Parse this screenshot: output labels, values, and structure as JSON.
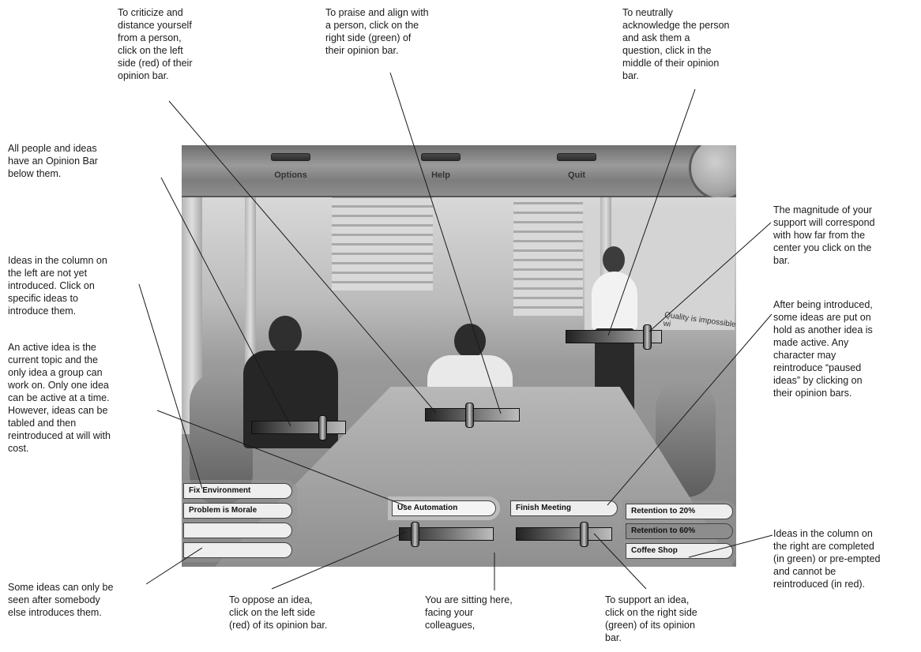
{
  "menu": {
    "options": "Options",
    "help": "Help",
    "quit": "Quit"
  },
  "scene": {
    "wall_sign": "Quality is impossible wi"
  },
  "ideas_left": [
    "Fix Environment",
    "Problem is Morale",
    "",
    ""
  ],
  "active_idea": "Use Automation",
  "paused_idea": "Finish Meeting",
  "ideas_right": [
    "Retention to 20%",
    "Retention to 60%",
    "Coffee Shop"
  ],
  "opinion_bars": {
    "person_left": 0.78,
    "person_center": 0.46,
    "person_right": 0.88,
    "active_idea": 0.13,
    "paused_idea": 0.73
  },
  "colors": {
    "oppose_side": "#cc0000",
    "support_side": "#009900"
  },
  "annotations": {
    "criticize": "To criticize and\ndistance yourself\nfrom a person,\nclick on the left\nside (red) of their\nopinion bar.",
    "praise": "To praise and align with\na person, click on the\nright side (green) of\ntheir opinion bar.",
    "neutral": "To neutrally\nacknowledge the person\nand ask them a\nquestion, click in the\nmiddle of their opinion\nbar.",
    "opinion_bar": "All people and ideas\nhave an Opinion Bar\nbelow them.",
    "magnitude": "The magnitude of your\nsupport will correspond\nwith how far from the\ncenter you click on the\nbar.",
    "left_column": "Ideas in the column on\nthe left are not yet\nintroduced. Click on\nspecific ideas to\nintroduce them.",
    "paused": "After being introduced,\nsome ideas are put on\nhold as another idea is\nmade active. Any\ncharacter may\nreintroduce “paused\nideas” by clicking on\ntheir opinion bars.",
    "active": "An active idea is the\ncurrent topic and the\nonly idea a group can\nwork on. Only one idea\ncan be active at a time.\nHowever, ideas can be\ntabled and then\nreintroduced at will with\ncost.",
    "right_column": "Ideas in the column on\nthe right are completed\n(in green) or pre-empted\nand cannot be\nreintroduced (in red).",
    "hidden_ideas": "Some ideas can only be\nseen after somebody\nelse introduces them.",
    "oppose": "To oppose an idea,\nclick on the left side\n(red) of its opinion bar.",
    "sitting": "You are sitting here,\nfacing your\ncolleagues,",
    "support": "To support an idea,\nclick on the right side\n(green) of its opinion\nbar."
  }
}
